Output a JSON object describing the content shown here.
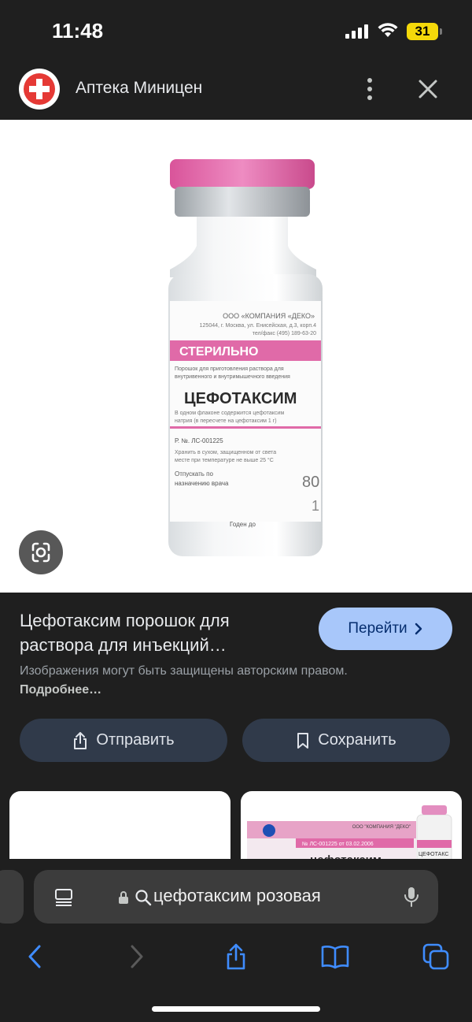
{
  "status": {
    "time": "11:48",
    "battery": "31"
  },
  "header": {
    "site_name": "Аптека Миницен"
  },
  "image": {
    "vial_text": {
      "company": "ООО «КОМПАНИЯ «ДЕКО»",
      "address": "125044, г. Москва, ул. Енисейская, д.3, корп.4",
      "phone": "тел/факс (495) 189-63-20",
      "sterile": "СТЕРИЛЬНО",
      "description1": "Порошок для приготовления раствора для",
      "description2": "внутривенного и внутримышечного введения",
      "name": "ЦЕФОТАКСИМ",
      "composition1": "В одном флаконе содержится цефотаксим",
      "composition2": "натрия (в пересчете на цефотаксим 1 г)",
      "reg": "Р. №. ЛС-001225",
      "storage1": "Хранить в сухом, защищенном от света",
      "storage2": "месте при температуре не выше 25 °С",
      "dispense1": "Отпускать по",
      "dispense2": "назначению врача",
      "expiry": "Годен до",
      "batch_partial": "80",
      "batch_partial2": "1"
    },
    "lens_icon": "google-lens-icon"
  },
  "result": {
    "title": "Цефотаксим порошок для раствора для инъекций…",
    "visit_label": "Перейти",
    "copyright_text": "Изображения могут быть защищены авторским правом.",
    "more_link": "Подробнее…"
  },
  "actions": {
    "share_label": "Отправить",
    "save_label": "Сохранить"
  },
  "thumbnails": {
    "second_box_name": "цефотаксим",
    "second_box_reg": "№ ЛС-001225 от 03.02.2006",
    "second_box_company": "ООО \"КОМПАНИЯ \"ДЕКО\"",
    "second_box_vial": "ЦЕФОТАКС"
  },
  "address_bar": {
    "query": "цефотаксим розовая"
  },
  "colors": {
    "accent": "#a8c7fa",
    "pill": "#303a4a",
    "pink": "#e06aa8",
    "background": "#1f1f1f"
  }
}
